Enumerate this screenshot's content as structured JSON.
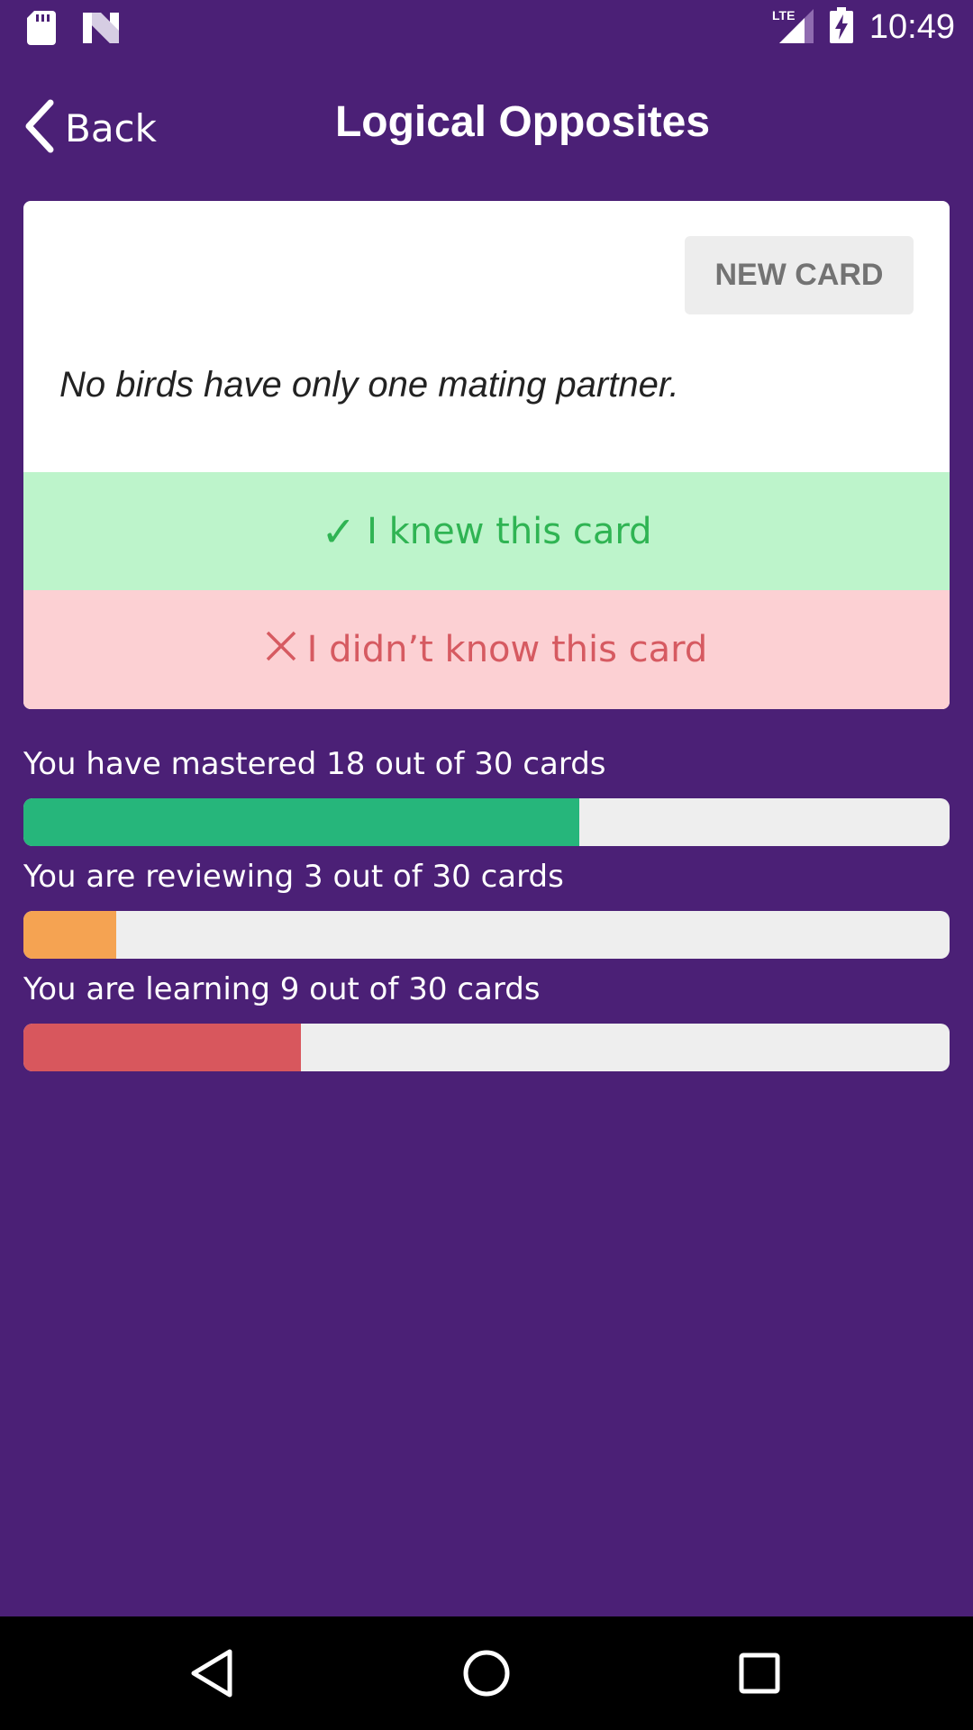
{
  "status_bar": {
    "time": "10:49",
    "network": "LTE",
    "icons": [
      "sd-card-icon",
      "n-logo-icon",
      "lte-signal-icon",
      "battery-charging-icon"
    ]
  },
  "app_bar": {
    "back_label": "Back",
    "title": "Logical Opposites",
    "icons": [
      "chevron-left-icon"
    ]
  },
  "card": {
    "new_card_label": "NEW CARD",
    "text": "No birds have only one mating partner.",
    "knew_label": "I knew this card",
    "knew_icon": "check-icon",
    "didnt_label": "I didn’t know this card",
    "didnt_icon": "x-icon"
  },
  "progress": [
    {
      "label": "You have mastered 18 out of 30 cards",
      "value": 18,
      "total": 30,
      "color": "#26b67b"
    },
    {
      "label": "You are reviewing 3 out of 30 cards",
      "value": 3,
      "total": 30,
      "color": "#f5a352"
    },
    {
      "label": "You are learning 9 out of 30 cards",
      "value": 9,
      "total": 30,
      "color": "#d8575d"
    }
  ],
  "nav_bar": {
    "icons": [
      "back-triangle-icon",
      "home-circle-icon",
      "recents-square-icon"
    ]
  },
  "colors": {
    "background": "#4b2076",
    "knew_bg": "#bdf4cb",
    "knew_text": "#2fb453",
    "didnt_bg": "#fcd0d3",
    "didnt_text": "#d65a61"
  }
}
